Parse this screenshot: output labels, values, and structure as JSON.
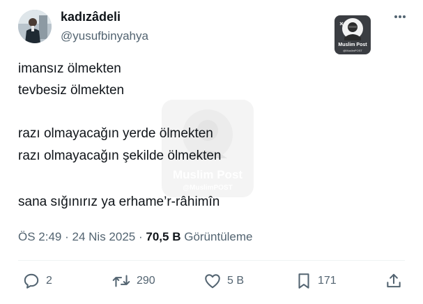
{
  "author": {
    "display_name": "kadızâdeli",
    "handle": "@yusufbinyahya",
    "avatar_icon": "person-avatar"
  },
  "more_icon": "more-horizontal-icon",
  "badge": {
    "label": "Muslim Post",
    "handle": "@MuslimPOST"
  },
  "watermark": {
    "label": "Muslim Post",
    "handle": "@MuslimPOST"
  },
  "tweet": {
    "lines": [
      "imansız ölmekten",
      "tevbesiz ölmekten",
      "razı olmayacağın yerde ölmekten",
      "razı olmayacağın şekilde ölmekten",
      "sana sığınırız ya erhame’r-râhimîn"
    ]
  },
  "meta": {
    "time": "ÖS 2:49",
    "separator": "·",
    "date": "24 Nis 2025",
    "views_count": "70,5 B",
    "views_label": "Görüntüleme"
  },
  "actions": {
    "reply": {
      "icon": "reply-icon",
      "count": "2"
    },
    "retweet": {
      "icon": "retweet-icon",
      "count": "290"
    },
    "like": {
      "icon": "heart-icon",
      "count": "5 B"
    },
    "bookmark": {
      "icon": "bookmark-icon",
      "count": "171"
    },
    "share": {
      "icon": "share-icon"
    }
  },
  "colors": {
    "text_primary": "#0f1419",
    "text_secondary": "#536471",
    "divider": "#eff3f4"
  }
}
